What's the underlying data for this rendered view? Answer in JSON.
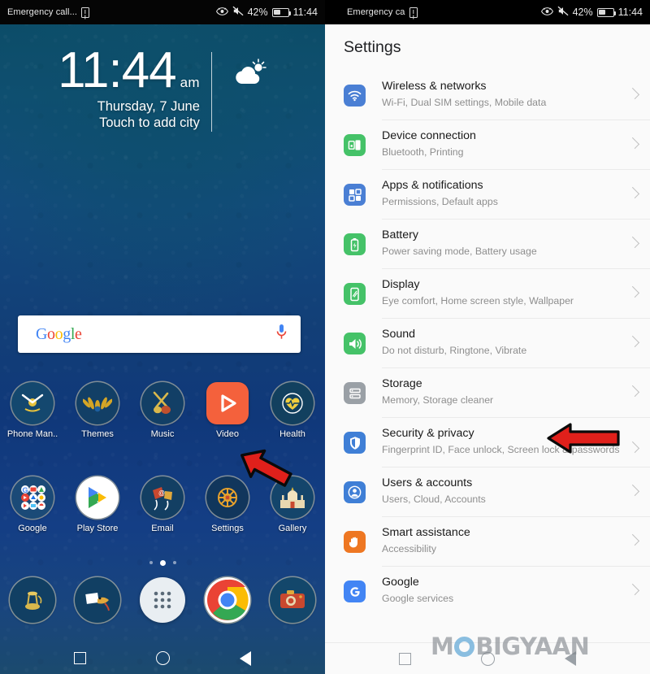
{
  "left_phone": {
    "status_bar": {
      "carrier": "Emergency call...",
      "sim_icon": "sim-card-icon",
      "eye_icon": "eye-comfort-icon",
      "mute_icon": "mute-icon",
      "battery_percent": "42%",
      "battery_icon": "battery-icon",
      "time": "11:44"
    },
    "clock_widget": {
      "time": "11:44",
      "ampm": "am",
      "date": "Thursday, 7 June",
      "city_hint": "Touch to add city",
      "weather_icon": "partly-cloudy-icon"
    },
    "google_search": {
      "logo_letters": [
        "G",
        "o",
        "o",
        "g",
        "l",
        "e"
      ],
      "mic_icon": "microphone-icon"
    },
    "app_rows": [
      [
        {
          "label": "Phone Man..",
          "icon": "phone-manager-icon",
          "glyph": "✖",
          "bg": "#14486f",
          "shape": "circle"
        },
        {
          "label": "Themes",
          "icon": "themes-icon",
          "glyph": "✿",
          "bg": "#123f66",
          "shape": "circle"
        },
        {
          "label": "Music",
          "icon": "music-icon",
          "glyph": "♫",
          "bg": "#123f66",
          "shape": "circle"
        },
        {
          "label": "Video",
          "icon": "video-icon",
          "glyph": "▶",
          "bg": "#F4613C",
          "shape": "square"
        },
        {
          "label": "Health",
          "icon": "health-icon",
          "glyph": "♥",
          "bg": "#12405f",
          "shape": "circle"
        }
      ],
      [
        {
          "label": "Google",
          "icon": "google-folder-icon",
          "glyph": "",
          "bg": "#1b4a77",
          "shape": "circle"
        },
        {
          "label": "Play Store",
          "icon": "play-store-icon",
          "glyph": "▶",
          "bg": "#ffffff",
          "shape": "circle"
        },
        {
          "label": "Email",
          "icon": "email-icon",
          "glyph": "@",
          "bg": "#133f63",
          "shape": "circle"
        },
        {
          "label": "Settings",
          "icon": "settings-icon",
          "glyph": "☸",
          "bg": "#11365c",
          "shape": "circle"
        },
        {
          "label": "Gallery",
          "icon": "gallery-icon",
          "glyph": "⌂",
          "bg": "#14456b",
          "shape": "circle"
        }
      ]
    ],
    "dock": [
      {
        "label": "",
        "icon": "phone-dialer-icon",
        "glyph": "☎",
        "bg": "#113f63",
        "shape": "circle"
      },
      {
        "label": "",
        "icon": "messages-icon",
        "glyph": "✉",
        "bg": "#113f63",
        "shape": "circle"
      },
      {
        "label": "",
        "icon": "app-drawer-icon",
        "glyph": "",
        "bg": "#e9eef2",
        "shape": "circle"
      },
      {
        "label": "",
        "icon": "chrome-icon",
        "glyph": "",
        "bg": "#ffffff",
        "shape": "circle"
      },
      {
        "label": "",
        "icon": "camera-icon",
        "glyph": "◎",
        "bg": "#13476b",
        "shape": "circle"
      }
    ],
    "page_dots": {
      "count": 3,
      "active_index": 1
    },
    "nav_bar": {
      "recents_icon": "recents-square-icon",
      "home_icon": "home-circle-icon",
      "back_icon": "back-triangle-icon"
    },
    "annotation_arrow": {
      "name": "red-arrow-settings",
      "color": "#E0201B",
      "direction": "down-left"
    }
  },
  "right_phone": {
    "status_bar": {
      "carrier": "Emergency ca",
      "sim_icon": "sim-card-icon",
      "eye_icon": "eye-comfort-icon",
      "mute_icon": "mute-icon",
      "battery_percent": "42%",
      "battery_icon": "battery-icon",
      "time": "11:44"
    },
    "header": {
      "title": "Settings"
    },
    "items": [
      {
        "title": "Wireless & networks",
        "subtitle": "Wi-Fi, Dual SIM settings, Mobile data",
        "icon": "wifi-icon",
        "bg": "#4A7FD4"
      },
      {
        "title": "Device connection",
        "subtitle": "Bluetooth, Printing",
        "icon": "device-connection-icon",
        "bg": "#45C268"
      },
      {
        "title": "Apps & notifications",
        "subtitle": "Permissions, Default apps",
        "icon": "apps-grid-icon",
        "bg": "#4A7FD4"
      },
      {
        "title": "Battery",
        "subtitle": "Power saving mode, Battery usage",
        "icon": "battery-icon",
        "bg": "#45C268"
      },
      {
        "title": "Display",
        "subtitle": "Eye comfort, Home screen style, Wallpaper",
        "icon": "display-icon",
        "bg": "#45C268"
      },
      {
        "title": "Sound",
        "subtitle": "Do not disturb, Ringtone, Vibrate",
        "icon": "sound-icon",
        "bg": "#45C268"
      },
      {
        "title": "Storage",
        "subtitle": "Memory, Storage cleaner",
        "icon": "storage-icon",
        "bg": "#9AA0A6"
      },
      {
        "title": "Security & privacy",
        "subtitle": "Fingerprint ID, Face unlock, Screen lock & passwords",
        "icon": "shield-icon",
        "bg": "#3F7FD6"
      },
      {
        "title": "Users & accounts",
        "subtitle": "Users, Cloud, Accounts",
        "icon": "user-account-icon",
        "bg": "#3F7FD6"
      },
      {
        "title": "Smart assistance",
        "subtitle": "Accessibility",
        "icon": "hand-icon",
        "bg": "#EE7722"
      },
      {
        "title": "Google",
        "subtitle": "Google services",
        "icon": "google-g-icon",
        "bg": "#4285F4"
      }
    ],
    "nav_bar": {
      "recents_icon": "recents-square-icon",
      "home_icon": "home-circle-icon",
      "back_icon": "back-triangle-icon"
    },
    "annotation_arrow": {
      "name": "red-arrow-security-privacy",
      "color": "#E0201B",
      "direction": "left"
    }
  },
  "watermark": {
    "text_before": "M",
    "text_after": "BIGYAAN",
    "full": "MOBIGYAAN"
  }
}
